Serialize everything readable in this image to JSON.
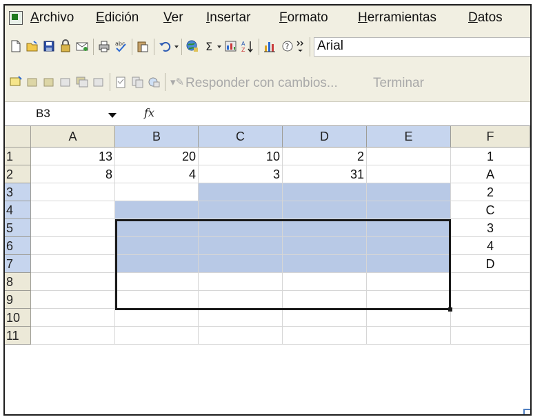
{
  "menu": {
    "items": [
      "Archivo",
      "Edición",
      "Ver",
      "Insertar",
      "Formato",
      "Herramientas",
      "Datos"
    ]
  },
  "toolbar1": {
    "icons": [
      "new-icon",
      "open-icon",
      "save-icon",
      "permission-icon",
      "email-icon",
      "print-icon",
      "spelling-icon",
      "paste-icon",
      "undo-icon",
      "research-icon",
      "autosum-icon",
      "insert-function-icon",
      "sort-ascending-icon",
      "chart-icon",
      "help-icon",
      "more-icon"
    ],
    "font_name": "Arial"
  },
  "toolbar2": {
    "reply_label": "Responder con cambios...",
    "finish_label": "Terminar"
  },
  "formula_bar": {
    "name_box": "B3",
    "fx_label": "fx",
    "formula": ""
  },
  "sheet": {
    "columns": [
      "A",
      "B",
      "C",
      "D",
      "E",
      "F"
    ],
    "rows": [
      "1",
      "2",
      "3",
      "4",
      "5",
      "6",
      "7",
      "8",
      "9",
      "10",
      "11"
    ],
    "cells": {
      "r1": [
        "13",
        "20",
        "10",
        "2",
        "",
        "1"
      ],
      "r2": [
        "8",
        "4",
        "3",
        "31",
        "",
        "A"
      ],
      "r3": [
        "",
        "",
        "",
        "",
        "",
        "2"
      ],
      "r4": [
        "",
        "",
        "",
        "",
        "",
        "C"
      ],
      "r5": [
        "",
        "",
        "",
        "",
        "",
        "3"
      ],
      "r6": [
        "",
        "",
        "",
        "",
        "",
        "4"
      ],
      "r7": [
        "",
        "",
        "",
        "",
        "",
        "D"
      ]
    },
    "active_cell": "B3",
    "selection": "B3:E7"
  },
  "colors": {
    "selection_fill": "#b8c9e6",
    "selected_header": "#c6d5ee",
    "chrome": "#f1efe2"
  }
}
